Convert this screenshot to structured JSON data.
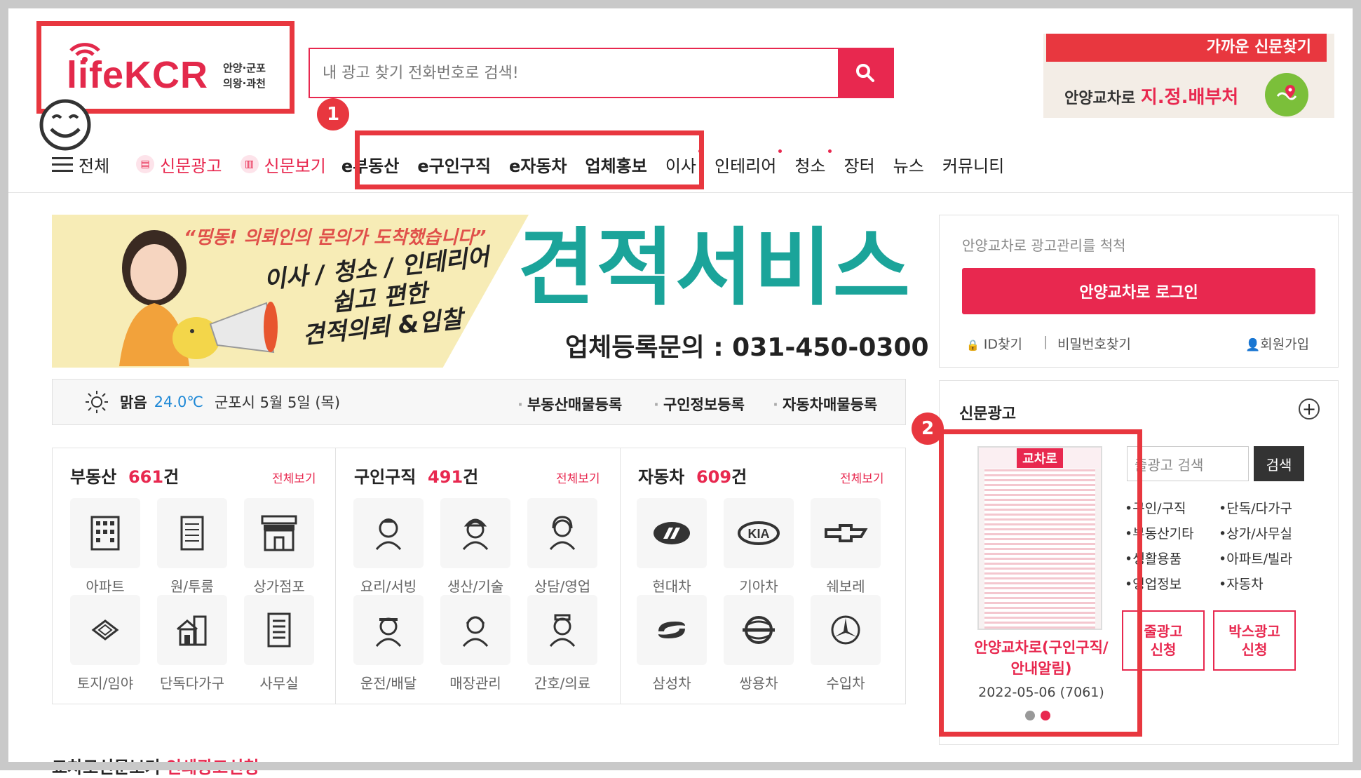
{
  "header": {
    "logo": "lifeKCR",
    "logo_region_line1": "안양·군포",
    "logo_region_line2": "의왕·과천",
    "search_placeholder": "내 광고 찾기 전화번호로 검색!",
    "nearby_title": "가까운 신문찾기",
    "nearby_prefix": "안양교차로",
    "nearby_highlight": "지.정.배부처"
  },
  "nav": {
    "all": "전체",
    "items": [
      "신문광고",
      "신문보기",
      "e부동산",
      "e구인구직",
      "e자동차",
      "업체홍보",
      "이사",
      "인테리어",
      "청소",
      "장터",
      "뉴스",
      "커뮤니티"
    ]
  },
  "annotations": {
    "badge1": "1",
    "badge2": "2"
  },
  "ad": {
    "slogan": "“띵동! 의뢰인의 문의가 도착했습니다”",
    "line1": "이사 / 청소 / 인테리어",
    "line2": "쉽고 편한",
    "line3": "견적의뢰 &입찰",
    "title": "견적서비스",
    "phone": "업체등록문의 : 031-450-0300"
  },
  "weather": {
    "condition": "맑음",
    "temp": "24.0℃",
    "date": "군포시 5월 5일 (목)",
    "links": [
      "부동산매물등록",
      "구인정보등록",
      "자동차매물등록"
    ]
  },
  "categories": [
    {
      "title": "부동산",
      "count": "661",
      "unit": "건",
      "more": "전체보기",
      "items": [
        "아파트",
        "원/투룸",
        "상가점포",
        "토지/임야",
        "단독다가구",
        "사무실"
      ]
    },
    {
      "title": "구인구직",
      "count": "491",
      "unit": "건",
      "more": "전체보기",
      "items": [
        "요리/서빙",
        "생산/기술",
        "상담/영업",
        "운전/배달",
        "매장관리",
        "간호/의료"
      ]
    },
    {
      "title": "자동차",
      "count": "609",
      "unit": "건",
      "more": "전체보기",
      "items": [
        "현대차",
        "기아차",
        "쉐보레",
        "삼성차",
        "쌍용차",
        "수입차"
      ]
    }
  ],
  "login": {
    "message": "안양교차로 광고관리를 척척",
    "button": "안양교차로 로그인",
    "find_id": "ID찾기",
    "find_pw": "비밀번호찾기",
    "signup": "회원가입"
  },
  "news_ad": {
    "title": "신문광고",
    "paper_label": "교차로",
    "caption_line1": "안양교차로(구인구직/",
    "caption_line2": "안내알림)",
    "date": "2022-05-06 (7061)",
    "search_placeholder": "줄광고 검색",
    "search_button": "검색",
    "cats_left": [
      "구인/구직",
      "부동산기타",
      "생활용품",
      "영업정보"
    ],
    "cats_right": [
      "단독/다가구",
      "상가/사무실",
      "아파트/빌라",
      "자동차"
    ],
    "btn_line": "줄광고\n신청",
    "btn_box": "박스광고\n신청"
  },
  "bottom": {
    "text": "교차로신문보기",
    "red": "인쇄광고신청"
  },
  "colors": {
    "brand": "#e8284f",
    "annotation": "#e8373f",
    "teal": "#1ba49a"
  }
}
